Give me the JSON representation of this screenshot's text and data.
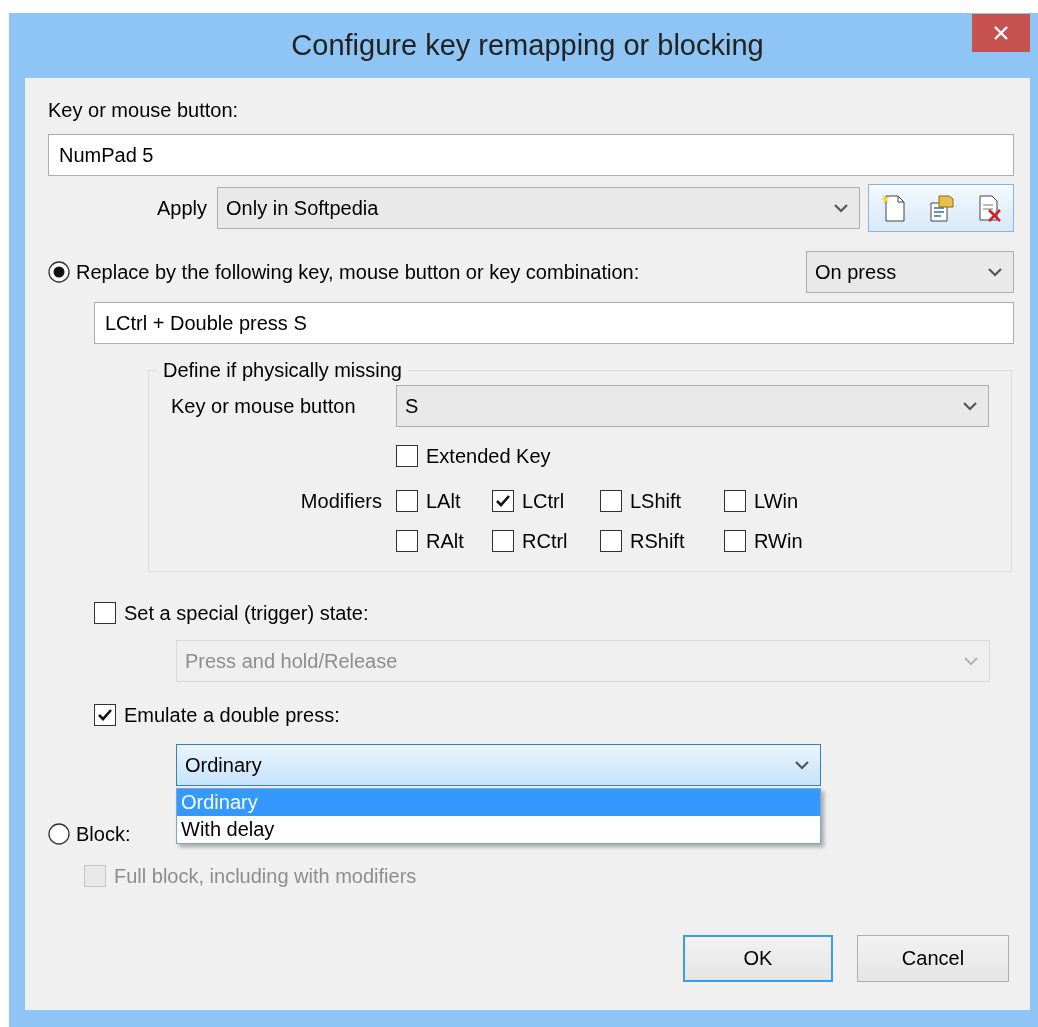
{
  "window": {
    "title": "Configure key remapping or blocking"
  },
  "key_label": "Key or mouse button:",
  "key_field": {
    "value": "NumPad 5"
  },
  "apply": {
    "label": "Apply",
    "value": "Only in Softpedia"
  },
  "replace": {
    "label": "Replace by the following key, mouse button or key combination:",
    "selected": true,
    "trigger": "On press",
    "value": "LCtrl + Double press S"
  },
  "missing": {
    "legend": "Define if physically missing",
    "key_label": "Key or mouse button",
    "key_value": "S",
    "extended": {
      "label": "Extended Key",
      "checked": false
    },
    "modifiers_label": "Modifiers",
    "modifier_rows": [
      {
        "items": [
          {
            "label": "LAlt",
            "checked": false
          },
          {
            "label": "LCtrl",
            "checked": true
          },
          {
            "label": "LShift",
            "checked": false
          },
          {
            "label": "LWin",
            "checked": false
          }
        ]
      },
      {
        "items": [
          {
            "label": "RAlt",
            "checked": false
          },
          {
            "label": "RCtrl",
            "checked": false
          },
          {
            "label": "RShift",
            "checked": false
          },
          {
            "label": "RWin",
            "checked": false
          }
        ]
      }
    ]
  },
  "special": {
    "label": "Set a special (trigger) state:",
    "checked": false,
    "combo": {
      "value": "Press and hold/Release",
      "disabled": true
    }
  },
  "double": {
    "label": "Emulate a double press:",
    "checked": true,
    "combo": {
      "value": "Ordinary",
      "expanded": true,
      "options": [
        {
          "label": "Ordinary",
          "selected": true
        },
        {
          "label": "With delay",
          "selected": false
        }
      ]
    }
  },
  "block": {
    "label": "Block:",
    "selected": false,
    "full": {
      "label": "Full block, including with modifiers",
      "checked": false,
      "disabled": true
    }
  },
  "buttons": [
    {
      "label": "OK",
      "default": true
    },
    {
      "label": "Cancel",
      "default": false
    }
  ]
}
